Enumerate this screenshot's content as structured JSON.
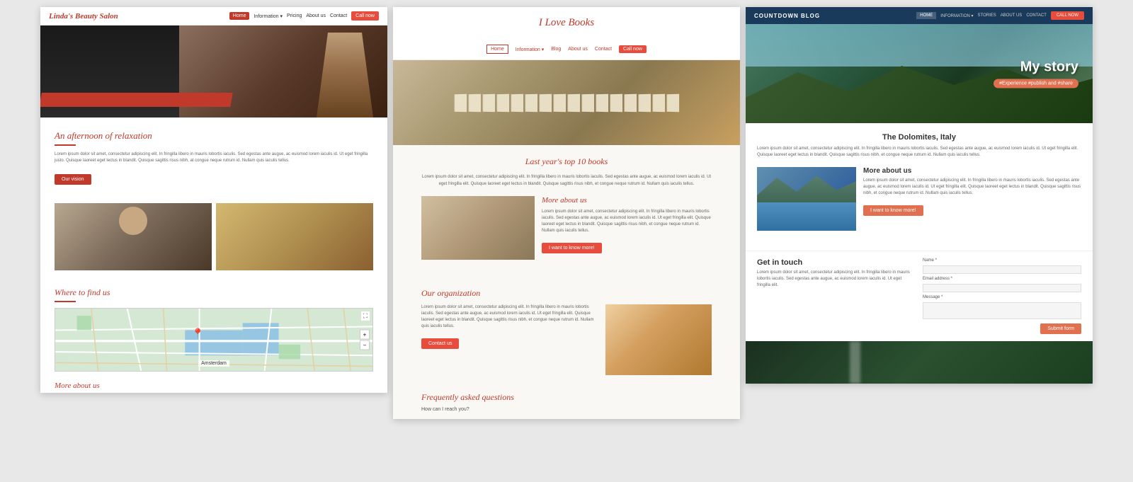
{
  "card1": {
    "logo": "Linda's Beauty Salon",
    "nav": {
      "items": [
        "Home",
        "Information",
        "Pricing",
        "About us",
        "Contact"
      ],
      "active": "Home",
      "btn": "Call now"
    },
    "heading1": "An afternoon of relaxation",
    "body_text": "Lorem ipsum dolor sit amet, consectetur adipiscing elit. In fringilla libero in mauris lobortis iaculis. Sed egestas ante augue, ac euismod lorem iaculis id. Ut eget fringilla justo. Quisque laoreet eget lectus in blandit. Quisque sagittis risus nibh, at congue neque rutrum id. Nullam quis iaculis tellus.",
    "btn1": "Our vision",
    "heading2": "Where to find us",
    "map_label": "Amsterdam",
    "footer_heading": "More about us"
  },
  "card2": {
    "logo": "I Love Books",
    "nav": {
      "items": [
        "Home",
        "Information",
        "Blog",
        "About us",
        "Contact"
      ],
      "active": "Home",
      "btn": "Call now"
    },
    "section1_title": "Last year's top 10 books",
    "section1_text": "Lorem ipsum dolor sit amet, consectetur adipiscing elit. In fringilla libero in mauris lobortis iaculis. Sed egestas ante augue, ac euismod lorem iaculis id. Ut eget fringilla elit. Quisque laoreet eget lectus in blandit. Quisque sagittis risus nibh, et congue neque rutrum id. Nullam quis iaculis tellus.",
    "col1_heading": "More about us",
    "col1_text": "Lorem ipsum dolor sit amet, consectetur adipiscing elit. In fringilla libero in mauris lobortis iaculis. Sed egestas ante augue, ac euismod lorem iaculis id. Ut eget fringilla elit. Quisque laoreet eget lectus in blandit. Quisque sagittis risus nibh, et congue neque rutrum id. Nullam quis iaculis tellus.",
    "col1_btn": "I want to know more!",
    "org_heading": "Our organization",
    "org_text": "Lorem ipsum dolor sit amet, consectetur adipiscing elit. In fringilla libero in mauris lobortis iaculis. Sed egestas ante augue, ac euismod lorem iaculis id. Ut eget fringilla elit. Quisque laoreet eget lectus in blandit. Quisque sagittis risus nibh, et congue neque rutrum id. Nullam quis iaculis tellus.",
    "contact_btn": "Contact us",
    "faq_heading": "Frequently asked questions",
    "faq_q": "How can I reach you?"
  },
  "card3": {
    "logo": "COUNTDOWN BLOG",
    "nav": {
      "items": [
        "HOME",
        "INFORMATION",
        "STORIES",
        "ABOUT US",
        "CONTACT"
      ],
      "active": "HOME",
      "btn": "CALL NOW"
    },
    "hero_title": "My story",
    "hero_tag": "#Experience #publish and #share",
    "section_title": "The Dolomites, Italy",
    "section_text": "Lorem ipsum dolor sit amet, consectetur adipiscing elit. In fringilla libero in mauris lobortis iaculis. Sed egestas ante augue, ac euismod lorem iaculis id. Ut eget fringilla elit. Quisque laoreet eget lectus in blandit. Quisque sagittis risus nibh, et congue neque rutrum id. Nullam quis iaculis tellus.",
    "col_heading": "More about us",
    "col_text": "Lorem ipsum dolor sit amet, consectetur adipiscing elit. In fringilla libero in mauris lobortis iaculis. Sed egestas ante augue, ac euismod lorem iaculis id. Ut eget fringilla elit. Quisque laoreet eget lectus in blandit. Quisque sagittis risus nibh, et congue neque rutrum id. Nullam quis iaculis tellus.",
    "col_btn": "I want to know more!",
    "contact_heading": "Get in touch",
    "contact_text": "Lorem ipsum dolor sit amet, consectetur adipiscing elit. In fringilla libero in mauris lobortis iaculis. Sed egestas ante augue, ac euismod lorem iaculis id. Ut eget fringilla elit.",
    "form_name": "Name *",
    "form_email": "Email address *",
    "form_message": "Message *",
    "submit_btn": "Submit form"
  }
}
